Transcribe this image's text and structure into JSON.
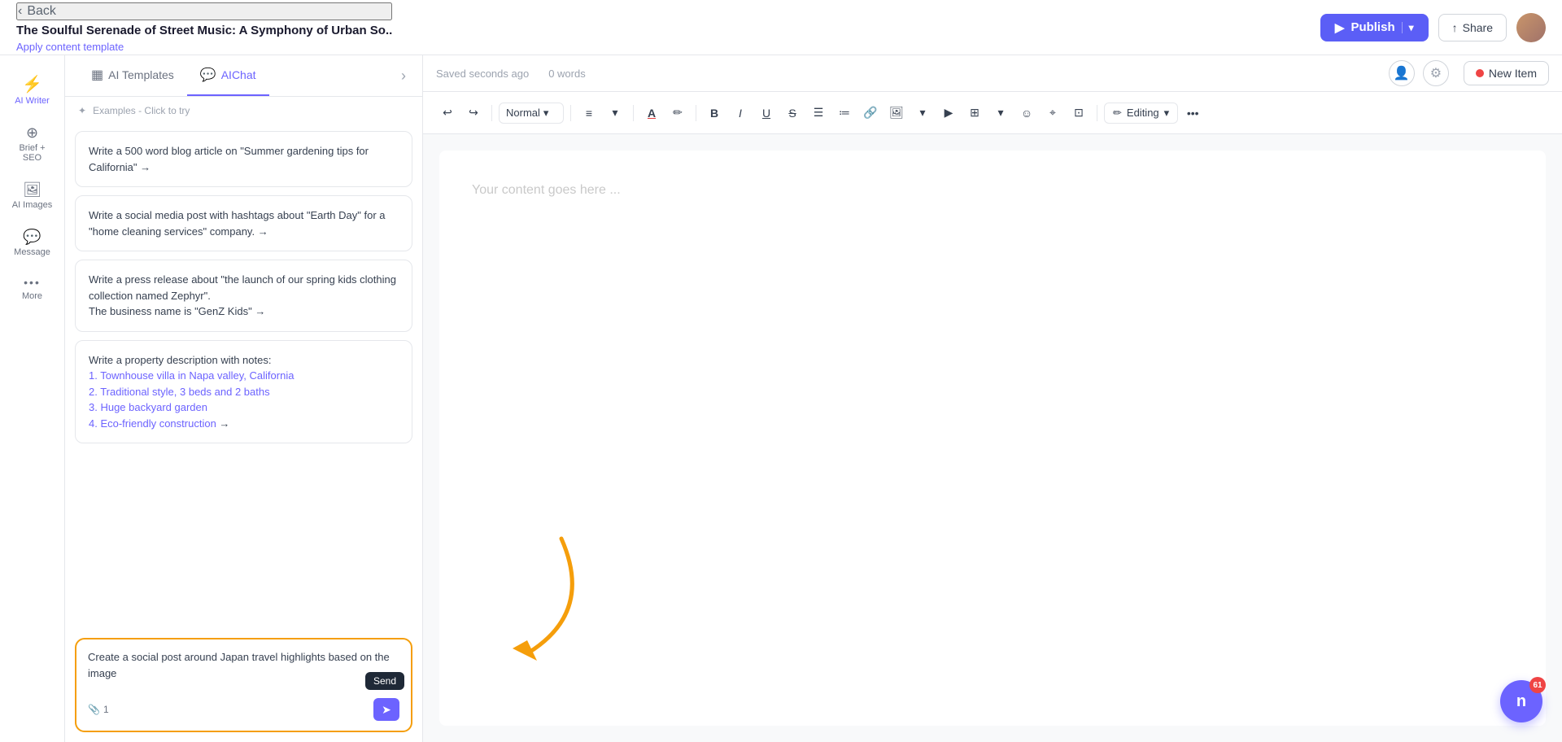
{
  "header": {
    "back_label": "Back",
    "doc_title": "The Soulful Serenade of Street Music: A Symphony of Urban So..",
    "apply_template_label": "Apply content template",
    "publish_label": "Publish",
    "share_label": "Share"
  },
  "sidebar": {
    "items": [
      {
        "id": "ai-writer",
        "icon": "⚡",
        "label": "AI Writer",
        "active": true
      },
      {
        "id": "brief-seo",
        "icon": "⊕",
        "label": "Brief + SEO",
        "active": false
      },
      {
        "id": "ai-images",
        "icon": "🖼",
        "label": "AI Images",
        "active": false
      },
      {
        "id": "message",
        "icon": "💬",
        "label": "Message",
        "active": false
      },
      {
        "id": "more",
        "icon": "···",
        "label": "More",
        "active": false
      }
    ]
  },
  "ai_panel": {
    "tabs": [
      {
        "id": "ai-templates",
        "icon": "▦",
        "label": "AI Templates",
        "active": false
      },
      {
        "id": "ai-chat",
        "icon": "💬",
        "label": "AIChat",
        "active": true
      }
    ],
    "examples_label": "Examples - Click to try",
    "templates": [
      {
        "id": "blog-article",
        "text": "Write a 500 word blog article on \"Summer gardening tips for California\" →"
      },
      {
        "id": "social-media",
        "text": "Write a social media post with hashtags about \"Earth Day\" for a \"home cleaning services\" company. →"
      },
      {
        "id": "press-release",
        "text": "Write a press release about \"the launch of our spring kids clothing collection named Zephyr\".\nThe business name is \"GenZ Kids\" →"
      },
      {
        "id": "property-desc",
        "items": [
          "Write a property description with notes:",
          "1. Townhouse villa in Napa valley, California",
          "2. Traditional style, 3 beds and 2 baths",
          "3. Huge backyard garden",
          "4. Eco-friendly construction →"
        ]
      }
    ],
    "input": {
      "text": "Create a social post around Japan travel highlights based on the image",
      "attach_count": "1",
      "send_label": "Send"
    }
  },
  "toolbar": {
    "saved_status": "Saved seconds ago",
    "word_count": "0 words",
    "format_label": "Normal",
    "editing_label": "Editing",
    "new_item_label": "New Item",
    "content_placeholder": "Your content goes here ..."
  },
  "chat": {
    "badge_count": "61"
  }
}
